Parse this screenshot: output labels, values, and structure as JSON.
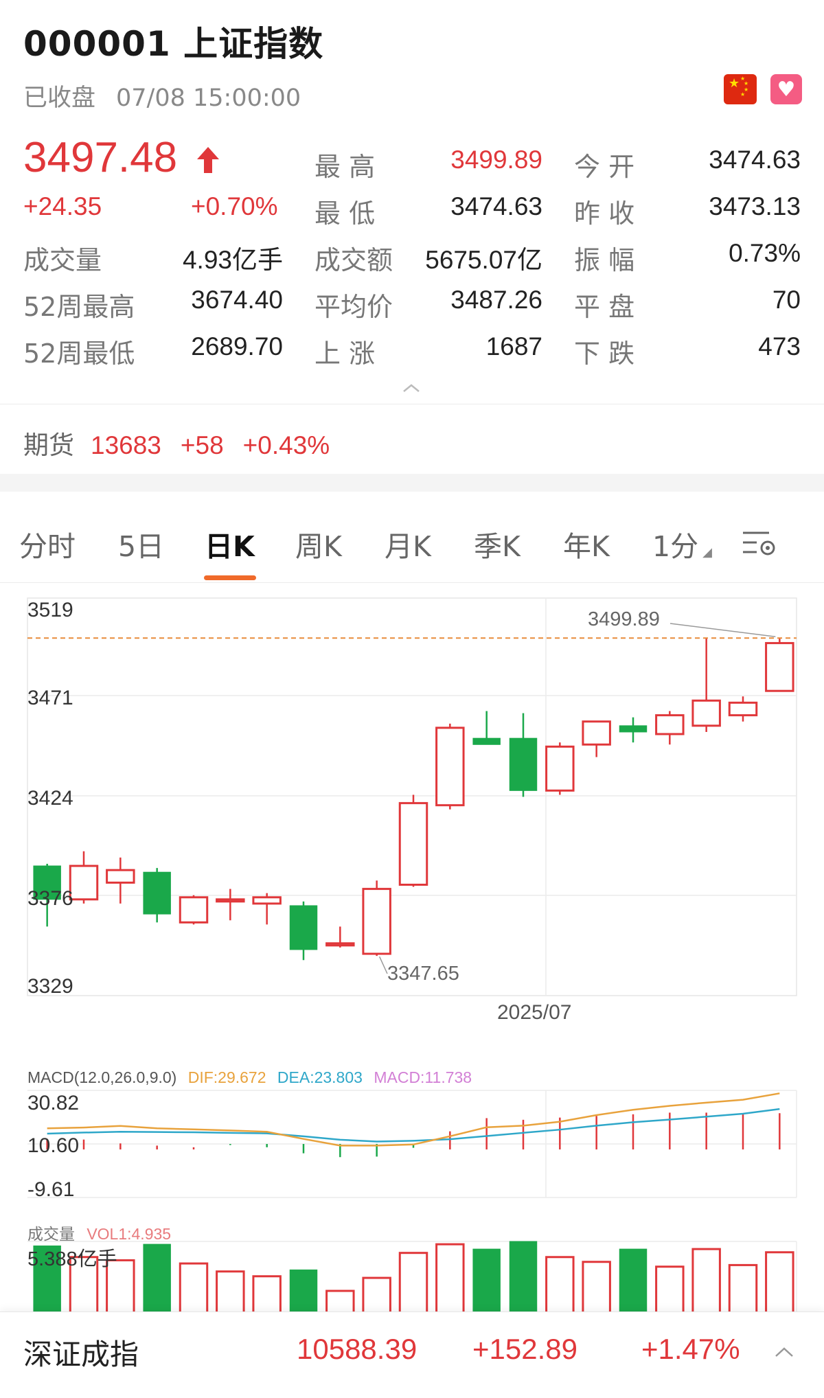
{
  "header": {
    "title": "000001  上证指数",
    "status": "已收盘",
    "datetime": "07/08 15:00:00"
  },
  "quote": {
    "price": "3497.48",
    "change": "+24.35",
    "change_pct": "+0.70%"
  },
  "stats": [
    {
      "label": "最 高",
      "value": "3499.89",
      "value_red": true
    },
    {
      "label": "今 开",
      "value": "3474.63",
      "value_red": false
    },
    {
      "label": "最 低",
      "value": "3474.63",
      "value_red": false
    },
    {
      "label": "昨 收",
      "value": "3473.13",
      "value_red": false
    },
    {
      "label": "成交量",
      "value": "4.93亿手",
      "value_red": false
    },
    {
      "label": "成交额",
      "value": "5675.07亿",
      "value_red": false
    },
    {
      "label": "振 幅",
      "value": "0.73%",
      "value_red": false
    },
    {
      "label": "52周最高",
      "value": "3674.40",
      "value_red": false
    },
    {
      "label": "平均价",
      "value": "3487.26",
      "value_red": false
    },
    {
      "label": "平 盘",
      "value": "70",
      "value_red": false
    },
    {
      "label": "52周最低",
      "value": "2689.70",
      "value_red": false
    },
    {
      "label": "上 涨",
      "value": "1687",
      "value_red": false
    },
    {
      "label": "下 跌",
      "value": "473",
      "value_red": false
    }
  ],
  "futures": {
    "label": "期货",
    "value": "13683",
    "change": "+58",
    "change_pct": "+0.43%"
  },
  "tabs": [
    "分时",
    "5日",
    "日K",
    "周K",
    "月K",
    "季K",
    "年K",
    "1分"
  ],
  "active_tab": "日K",
  "colors": {
    "up": "#e0373a",
    "down": "#1aa84a",
    "dif": "#e8a23c",
    "dea": "#2ea7c9",
    "macd": "#d27fd5",
    "highline": "#e88b3a"
  },
  "chart_data": [
    {
      "type": "candlestick",
      "y_ticks": [
        "3519",
        "3471",
        "3424",
        "3376",
        "3329"
      ],
      "ylim": [
        3329,
        3519
      ],
      "x_label": "2025/07",
      "high_label": "3499.89",
      "low_label": "3347.65",
      "candles": [
        {
          "o": 3391,
          "h": 3392,
          "l": 3362,
          "c": 3375
        },
        {
          "o": 3375,
          "h": 3398,
          "l": 3373,
          "c": 3391
        },
        {
          "o": 3383,
          "h": 3395,
          "l": 3373,
          "c": 3389
        },
        {
          "o": 3388,
          "h": 3390,
          "l": 3364,
          "c": 3368
        },
        {
          "o": 3364,
          "h": 3377,
          "l": 3363,
          "c": 3376
        },
        {
          "o": 3374,
          "h": 3380,
          "l": 3365,
          "c": 3375
        },
        {
          "o": 3373,
          "h": 3378,
          "l": 3363,
          "c": 3376
        },
        {
          "o": 3372,
          "h": 3374,
          "l": 3346,
          "c": 3351
        },
        {
          "o": 3353,
          "h": 3362,
          "l": 3352,
          "c": 3354
        },
        {
          "o": 3349,
          "h": 3384,
          "l": 3348,
          "c": 3380
        },
        {
          "o": 3382,
          "h": 3425,
          "l": 3381,
          "c": 3421
        },
        {
          "o": 3420,
          "h": 3459,
          "l": 3418,
          "c": 3457
        },
        {
          "o": 3452,
          "h": 3465,
          "l": 3449,
          "c": 3449
        },
        {
          "o": 3452,
          "h": 3464,
          "l": 3424,
          "c": 3427
        },
        {
          "o": 3427,
          "h": 3450,
          "l": 3425,
          "c": 3448
        },
        {
          "o": 3449,
          "h": 3460,
          "l": 3443,
          "c": 3460
        },
        {
          "o": 3458,
          "h": 3462,
          "l": 3450,
          "c": 3455
        },
        {
          "o": 3454,
          "h": 3465,
          "l": 3449,
          "c": 3463
        },
        {
          "o": 3458,
          "h": 3499.89,
          "l": 3455,
          "c": 3470
        },
        {
          "o": 3463,
          "h": 3472,
          "l": 3460,
          "c": 3469
        },
        {
          "o": 3474.63,
          "h": 3499.89,
          "l": 3474.63,
          "c": 3497.48
        }
      ]
    },
    {
      "type": "line",
      "name": "MACD",
      "header": "MACD(12.0,26.0,9.0)",
      "dif_label": "DIF:29.672",
      "dea_label": "DEA:23.803",
      "macd_label": "MACD:11.738",
      "y_ticks": [
        "30.82",
        "10.60",
        "-9.61"
      ],
      "ylim": [
        -9.61,
        30.82
      ],
      "dif": [
        16.5,
        16.8,
        17.4,
        16.5,
        16.1,
        15.7,
        15.2,
        12.5,
        10.0,
        10.0,
        10.4,
        13.5,
        16.9,
        17.5,
        19.0,
        21.5,
        23.5,
        25.0,
        26.2,
        27.3,
        29.7
      ],
      "dea": [
        14.5,
        14.9,
        15.2,
        15.1,
        15.0,
        14.8,
        14.6,
        13.5,
        12.2,
        11.5,
        11.8,
        12.4,
        13.6,
        14.8,
        16.0,
        17.5,
        18.8,
        19.8,
        20.9,
        22.0,
        23.8
      ],
      "macd": [
        1.9,
        1.8,
        1.1,
        0.7,
        0.4,
        -0.2,
        -0.6,
        -1.7,
        -2.4,
        -2.3,
        -0.7,
        3.3,
        5.7,
        5.4,
        5.8,
        6.1,
        6.4,
        6.7,
        6.7,
        6.6,
        6.6
      ]
    },
    {
      "type": "bar",
      "name": "成交量",
      "header_label": "成交量",
      "vol_label": "VOL1:4.935",
      "max_label": "5.388亿手",
      "values": [
        5.25,
        4.9,
        4.8,
        5.3,
        4.7,
        4.45,
        4.3,
        4.5,
        3.8,
        4.25,
        5.03,
        5.3,
        5.15,
        5.39,
        4.9,
        4.75,
        5.15,
        4.6,
        5.15,
        4.65,
        5.05
      ]
    }
  ],
  "bottom_bar": {
    "name": "深证成指",
    "value": "10588.39",
    "change": "+152.89",
    "change_pct": "+1.47%"
  }
}
